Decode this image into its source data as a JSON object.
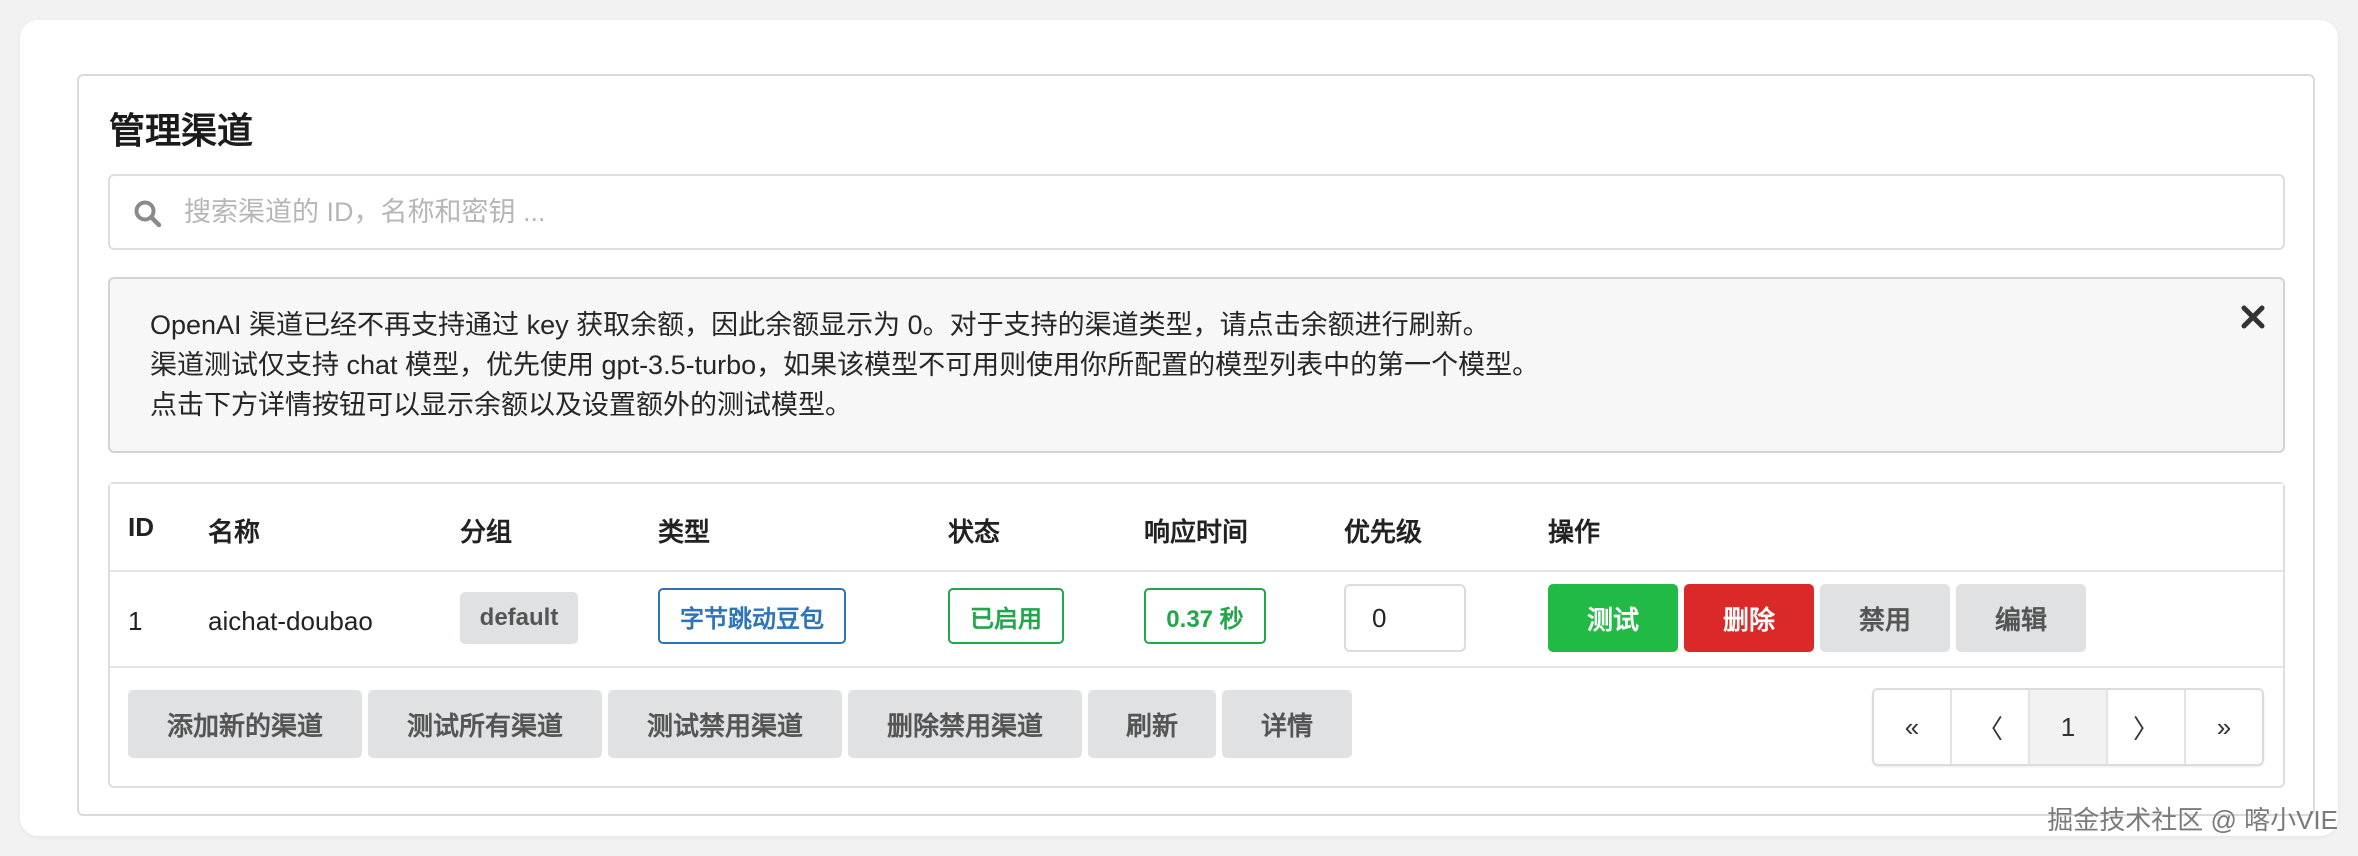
{
  "page": {
    "title": "管理渠道"
  },
  "search": {
    "placeholder": "搜索渠道的 ID，名称和密钥 ..."
  },
  "notice": {
    "lines": [
      "OpenAI 渠道已经不再支持通过 key 获取余额，因此余额显示为 0。对于支持的渠道类型，请点击余额进行刷新。",
      "渠道测试仅支持 chat 模型，优先使用 gpt-3.5-turbo，如果该模型不可用则使用你所配置的模型列表中的第一个模型。",
      "点击下方详情按钮可以显示余额以及设置额外的测试模型。"
    ]
  },
  "table": {
    "headers": [
      "ID",
      "名称",
      "分组",
      "类型",
      "状态",
      "响应时间",
      "优先级",
      "操作"
    ],
    "rows": [
      {
        "id": "1",
        "name": "aichat-doubao",
        "group": "default",
        "type": "字节跳动豆包",
        "status": "已启用",
        "response_time": "0.37 秒",
        "priority": "0",
        "actions": {
          "test": "测试",
          "delete": "删除",
          "disable": "禁用",
          "edit": "编辑"
        }
      }
    ]
  },
  "footer": {
    "buttons": [
      "添加新的渠道",
      "测试所有渠道",
      "测试禁用渠道",
      "删除禁用渠道",
      "刷新",
      "详情"
    ]
  },
  "pagination": {
    "first": "«",
    "prev": "〈",
    "current": "1",
    "next": "〉",
    "last": "»"
  },
  "watermark": "掘金技术社区 @ 喀小VIE",
  "colors": {
    "test": "#21ba45",
    "delete": "#db2828",
    "type_tag": "#2d74b8",
    "status_tag": "#21a64a"
  },
  "icons": {
    "search": "search-icon",
    "close": "close-icon"
  }
}
